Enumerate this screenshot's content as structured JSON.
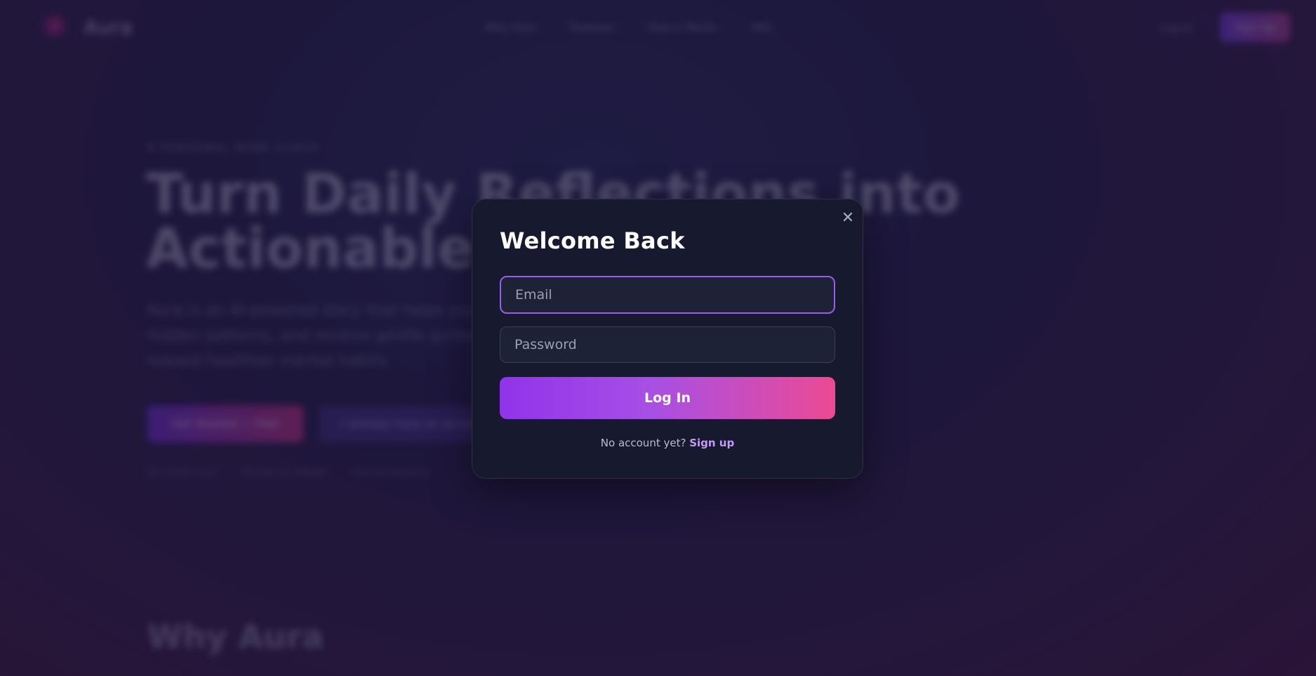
{
  "nav": {
    "brand": "Aura",
    "links": [
      "Why Aura",
      "Features",
      "How it Works",
      "FAQ"
    ],
    "login_label": "Log In",
    "signup_label": "Sign Up"
  },
  "hero": {
    "eyebrow": "A PERSONAL MIND CLOCK",
    "title_line1": "Turn Daily Reflections into",
    "title_line2_plain": "Actionable",
    "title_line2_accent": "",
    "description": "Aura is an AI-powered diary that helps you see hidden patterns, and receive gentle guidance toward healthier mental habits.",
    "cta_primary": "Get Started — Free",
    "cta_secondary": "I already have an account",
    "trust": [
      "No credit card",
      "Private by design",
      "Cancel anytime"
    ]
  },
  "section": {
    "title": "Why Aura"
  },
  "modal": {
    "title": "Welcome Back",
    "email_placeholder": "Email",
    "password_placeholder": "Password",
    "login_button": "Log In",
    "signup_prompt": "No account yet?",
    "signup_link": "Sign up",
    "close_symbol": "✕"
  },
  "colors": {
    "accent_purple": "#9133ea",
    "accent_pink": "#ec4a93",
    "focus_border": "#9b5ce6",
    "modal_bg": "#171a2e"
  }
}
